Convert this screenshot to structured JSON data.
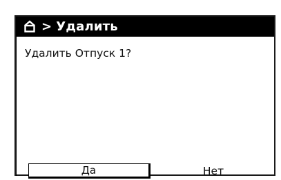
{
  "header": {
    "icon": "home-icon",
    "separator": ">",
    "title": "Удалить"
  },
  "dialog": {
    "question": "Удалить Отпуск 1?",
    "yes_label": "Да",
    "no_label": "Нет",
    "selected": "yes"
  },
  "colors": {
    "titlebar_bg": "#000000",
    "titlebar_fg": "#ffffff",
    "background": "#ffffff",
    "text": "#111111"
  }
}
